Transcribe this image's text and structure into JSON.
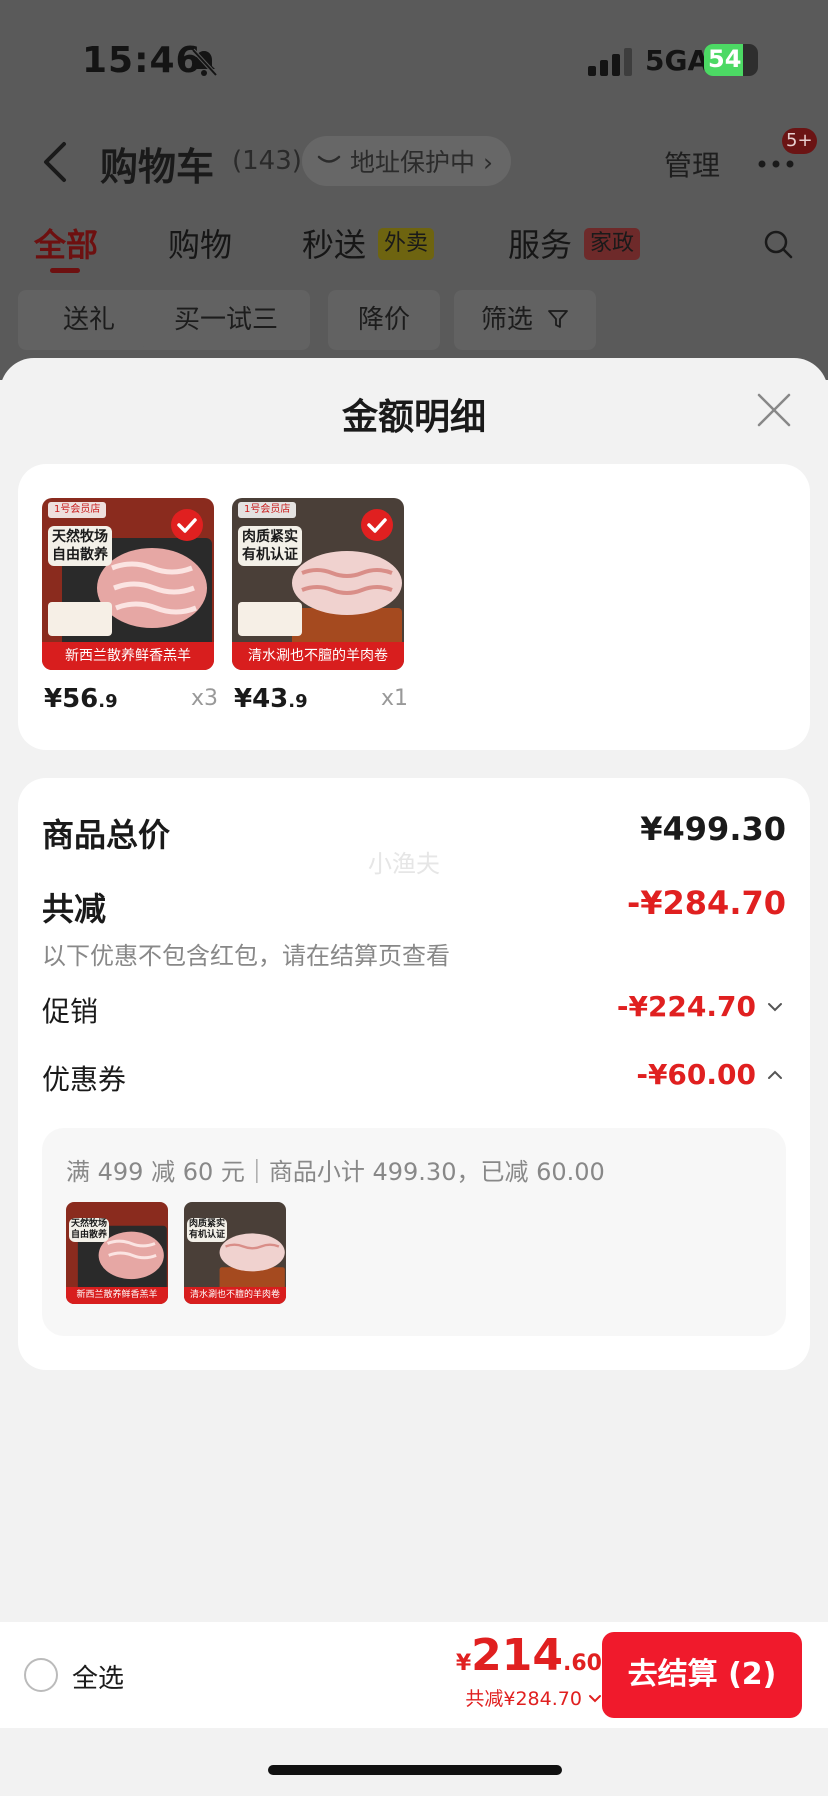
{
  "status_bar": {
    "time": "15:46",
    "network": "5GA",
    "battery": "54"
  },
  "header": {
    "title": "购物车",
    "count": "(143)",
    "address_protect": "地址保护中 ›",
    "manage": "管理",
    "more_badge": "5+"
  },
  "tabs": [
    {
      "label": "全部"
    },
    {
      "label": "购物"
    },
    {
      "label": "秒送",
      "tag": "外卖"
    },
    {
      "label": "服务",
      "tag": "家政"
    }
  ],
  "chips": [
    "送礼",
    "买一试三",
    "降价",
    "筛选"
  ],
  "sheet": {
    "title": "金额明细",
    "products": [
      {
        "tag_line1": "天然牧场",
        "tag_line2": "自由散养",
        "caption": "新西兰散养鲜香羔羊",
        "price_int": "¥56",
        "price_dec": ".9",
        "qty": "x3"
      },
      {
        "tag_line1": "肉质紧实",
        "tag_line2": "有机认证",
        "caption": "清水涮也不膻的羊肉卷",
        "price_int": "¥43",
        "price_dec": ".9",
        "qty": "x1"
      }
    ],
    "summary": {
      "total_label": "商品总价",
      "total_value": "¥499.30",
      "watermark": "小渔夫",
      "reduce_label": "共减",
      "reduce_value": "-¥284.70",
      "reduce_hint": "以下优惠不包含红包，请在结算页查看",
      "promo_label": "促销",
      "promo_value": "-¥224.70",
      "coupon_label": "优惠券",
      "coupon_value": "-¥60.00",
      "coupon_detail": "满 499 减 60 元｜商品小计 499.30，已减 60.00"
    }
  },
  "bottom_bar": {
    "select_all": "全选",
    "currency": "¥",
    "total_int": "214",
    "total_dec": ".60",
    "saved": "共减¥284.70",
    "checkout": "去结算 (2)"
  },
  "colors": {
    "accent": "#e02020",
    "checkout": "#f01a2c"
  }
}
